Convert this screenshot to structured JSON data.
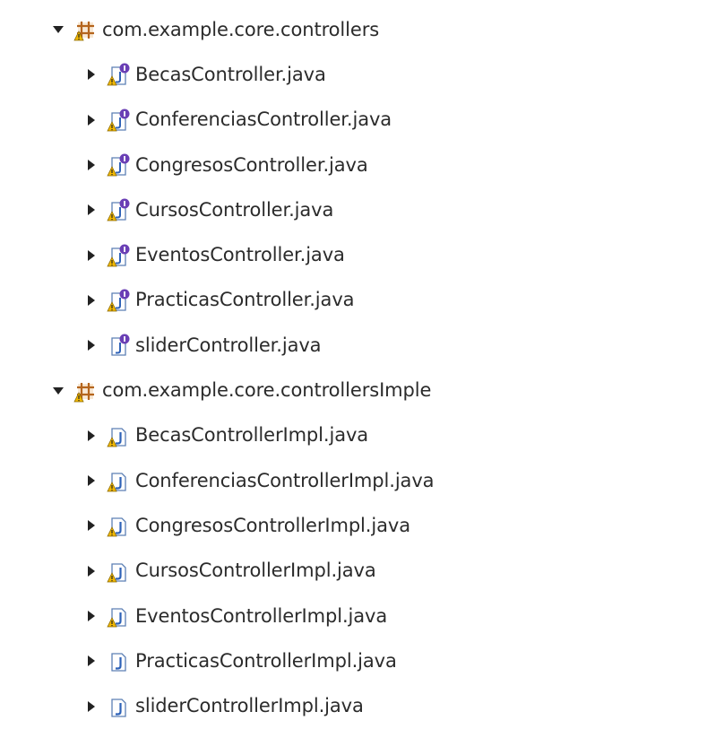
{
  "tree": {
    "packages": [
      {
        "name": "com.example.core.controllers",
        "expanded": true,
        "warning": true,
        "icon": "package-icon",
        "files": [
          {
            "name": "BecasController.java",
            "icon": "interface-icon",
            "warning": true
          },
          {
            "name": "ConferenciasController.java",
            "icon": "interface-icon",
            "warning": true
          },
          {
            "name": "CongresosController.java",
            "icon": "interface-icon",
            "warning": true
          },
          {
            "name": "CursosController.java",
            "icon": "interface-icon",
            "warning": true
          },
          {
            "name": "EventosController.java",
            "icon": "interface-icon",
            "warning": true
          },
          {
            "name": "PracticasController.java",
            "icon": "interface-icon",
            "warning": true
          },
          {
            "name": "sliderController.java",
            "icon": "interface-icon",
            "warning": false
          }
        ]
      },
      {
        "name": "com.example.core.controllersImple",
        "expanded": true,
        "warning": true,
        "icon": "package-icon",
        "files": [
          {
            "name": "BecasControllerImpl.java",
            "icon": "java-file-icon",
            "warning": true
          },
          {
            "name": "ConferenciasControllerImpl.java",
            "icon": "java-file-icon",
            "warning": true
          },
          {
            "name": "CongresosControllerImpl.java",
            "icon": "java-file-icon",
            "warning": true
          },
          {
            "name": "CursosControllerImpl.java",
            "icon": "java-file-icon",
            "warning": true
          },
          {
            "name": "EventosControllerImpl.java",
            "icon": "java-file-icon",
            "warning": true
          },
          {
            "name": "PracticasControllerImpl.java",
            "icon": "java-file-icon",
            "warning": false
          },
          {
            "name": "sliderControllerImpl.java",
            "icon": "java-file-icon",
            "warning": false
          }
        ]
      }
    ]
  },
  "colors": {
    "package_brown": "#b5651d",
    "interface_purple": "#6a3fb5",
    "java_blue": "#2e62b8",
    "warning_yellow": "#f2b800",
    "twisty": "#222222"
  }
}
